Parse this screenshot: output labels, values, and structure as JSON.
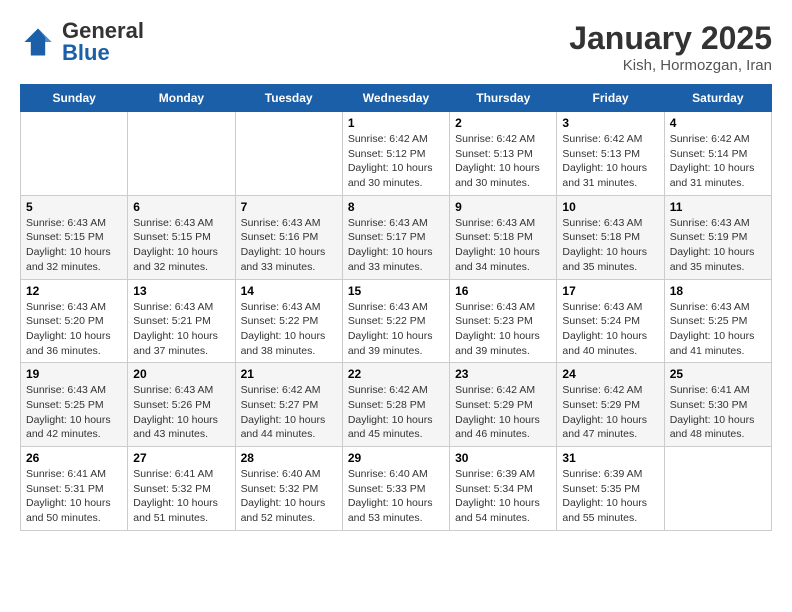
{
  "header": {
    "logo": {
      "general": "General",
      "blue": "Blue"
    },
    "title": "January 2025",
    "location": "Kish, Hormozgan, Iran"
  },
  "days_of_week": [
    "Sunday",
    "Monday",
    "Tuesday",
    "Wednesday",
    "Thursday",
    "Friday",
    "Saturday"
  ],
  "weeks": [
    [
      {
        "day": "",
        "info": ""
      },
      {
        "day": "",
        "info": ""
      },
      {
        "day": "",
        "info": ""
      },
      {
        "day": "1",
        "info": "Sunrise: 6:42 AM\nSunset: 5:12 PM\nDaylight: 10 hours\nand 30 minutes."
      },
      {
        "day": "2",
        "info": "Sunrise: 6:42 AM\nSunset: 5:13 PM\nDaylight: 10 hours\nand 30 minutes."
      },
      {
        "day": "3",
        "info": "Sunrise: 6:42 AM\nSunset: 5:13 PM\nDaylight: 10 hours\nand 31 minutes."
      },
      {
        "day": "4",
        "info": "Sunrise: 6:42 AM\nSunset: 5:14 PM\nDaylight: 10 hours\nand 31 minutes."
      }
    ],
    [
      {
        "day": "5",
        "info": "Sunrise: 6:43 AM\nSunset: 5:15 PM\nDaylight: 10 hours\nand 32 minutes."
      },
      {
        "day": "6",
        "info": "Sunrise: 6:43 AM\nSunset: 5:15 PM\nDaylight: 10 hours\nand 32 minutes."
      },
      {
        "day": "7",
        "info": "Sunrise: 6:43 AM\nSunset: 5:16 PM\nDaylight: 10 hours\nand 33 minutes."
      },
      {
        "day": "8",
        "info": "Sunrise: 6:43 AM\nSunset: 5:17 PM\nDaylight: 10 hours\nand 33 minutes."
      },
      {
        "day": "9",
        "info": "Sunrise: 6:43 AM\nSunset: 5:18 PM\nDaylight: 10 hours\nand 34 minutes."
      },
      {
        "day": "10",
        "info": "Sunrise: 6:43 AM\nSunset: 5:18 PM\nDaylight: 10 hours\nand 35 minutes."
      },
      {
        "day": "11",
        "info": "Sunrise: 6:43 AM\nSunset: 5:19 PM\nDaylight: 10 hours\nand 35 minutes."
      }
    ],
    [
      {
        "day": "12",
        "info": "Sunrise: 6:43 AM\nSunset: 5:20 PM\nDaylight: 10 hours\nand 36 minutes."
      },
      {
        "day": "13",
        "info": "Sunrise: 6:43 AM\nSunset: 5:21 PM\nDaylight: 10 hours\nand 37 minutes."
      },
      {
        "day": "14",
        "info": "Sunrise: 6:43 AM\nSunset: 5:22 PM\nDaylight: 10 hours\nand 38 minutes."
      },
      {
        "day": "15",
        "info": "Sunrise: 6:43 AM\nSunset: 5:22 PM\nDaylight: 10 hours\nand 39 minutes."
      },
      {
        "day": "16",
        "info": "Sunrise: 6:43 AM\nSunset: 5:23 PM\nDaylight: 10 hours\nand 39 minutes."
      },
      {
        "day": "17",
        "info": "Sunrise: 6:43 AM\nSunset: 5:24 PM\nDaylight: 10 hours\nand 40 minutes."
      },
      {
        "day": "18",
        "info": "Sunrise: 6:43 AM\nSunset: 5:25 PM\nDaylight: 10 hours\nand 41 minutes."
      }
    ],
    [
      {
        "day": "19",
        "info": "Sunrise: 6:43 AM\nSunset: 5:25 PM\nDaylight: 10 hours\nand 42 minutes."
      },
      {
        "day": "20",
        "info": "Sunrise: 6:43 AM\nSunset: 5:26 PM\nDaylight: 10 hours\nand 43 minutes."
      },
      {
        "day": "21",
        "info": "Sunrise: 6:42 AM\nSunset: 5:27 PM\nDaylight: 10 hours\nand 44 minutes."
      },
      {
        "day": "22",
        "info": "Sunrise: 6:42 AM\nSunset: 5:28 PM\nDaylight: 10 hours\nand 45 minutes."
      },
      {
        "day": "23",
        "info": "Sunrise: 6:42 AM\nSunset: 5:29 PM\nDaylight: 10 hours\nand 46 minutes."
      },
      {
        "day": "24",
        "info": "Sunrise: 6:42 AM\nSunset: 5:29 PM\nDaylight: 10 hours\nand 47 minutes."
      },
      {
        "day": "25",
        "info": "Sunrise: 6:41 AM\nSunset: 5:30 PM\nDaylight: 10 hours\nand 48 minutes."
      }
    ],
    [
      {
        "day": "26",
        "info": "Sunrise: 6:41 AM\nSunset: 5:31 PM\nDaylight: 10 hours\nand 50 minutes."
      },
      {
        "day": "27",
        "info": "Sunrise: 6:41 AM\nSunset: 5:32 PM\nDaylight: 10 hours\nand 51 minutes."
      },
      {
        "day": "28",
        "info": "Sunrise: 6:40 AM\nSunset: 5:32 PM\nDaylight: 10 hours\nand 52 minutes."
      },
      {
        "day": "29",
        "info": "Sunrise: 6:40 AM\nSunset: 5:33 PM\nDaylight: 10 hours\nand 53 minutes."
      },
      {
        "day": "30",
        "info": "Sunrise: 6:39 AM\nSunset: 5:34 PM\nDaylight: 10 hours\nand 54 minutes."
      },
      {
        "day": "31",
        "info": "Sunrise: 6:39 AM\nSunset: 5:35 PM\nDaylight: 10 hours\nand 55 minutes."
      },
      {
        "day": "",
        "info": ""
      }
    ]
  ]
}
